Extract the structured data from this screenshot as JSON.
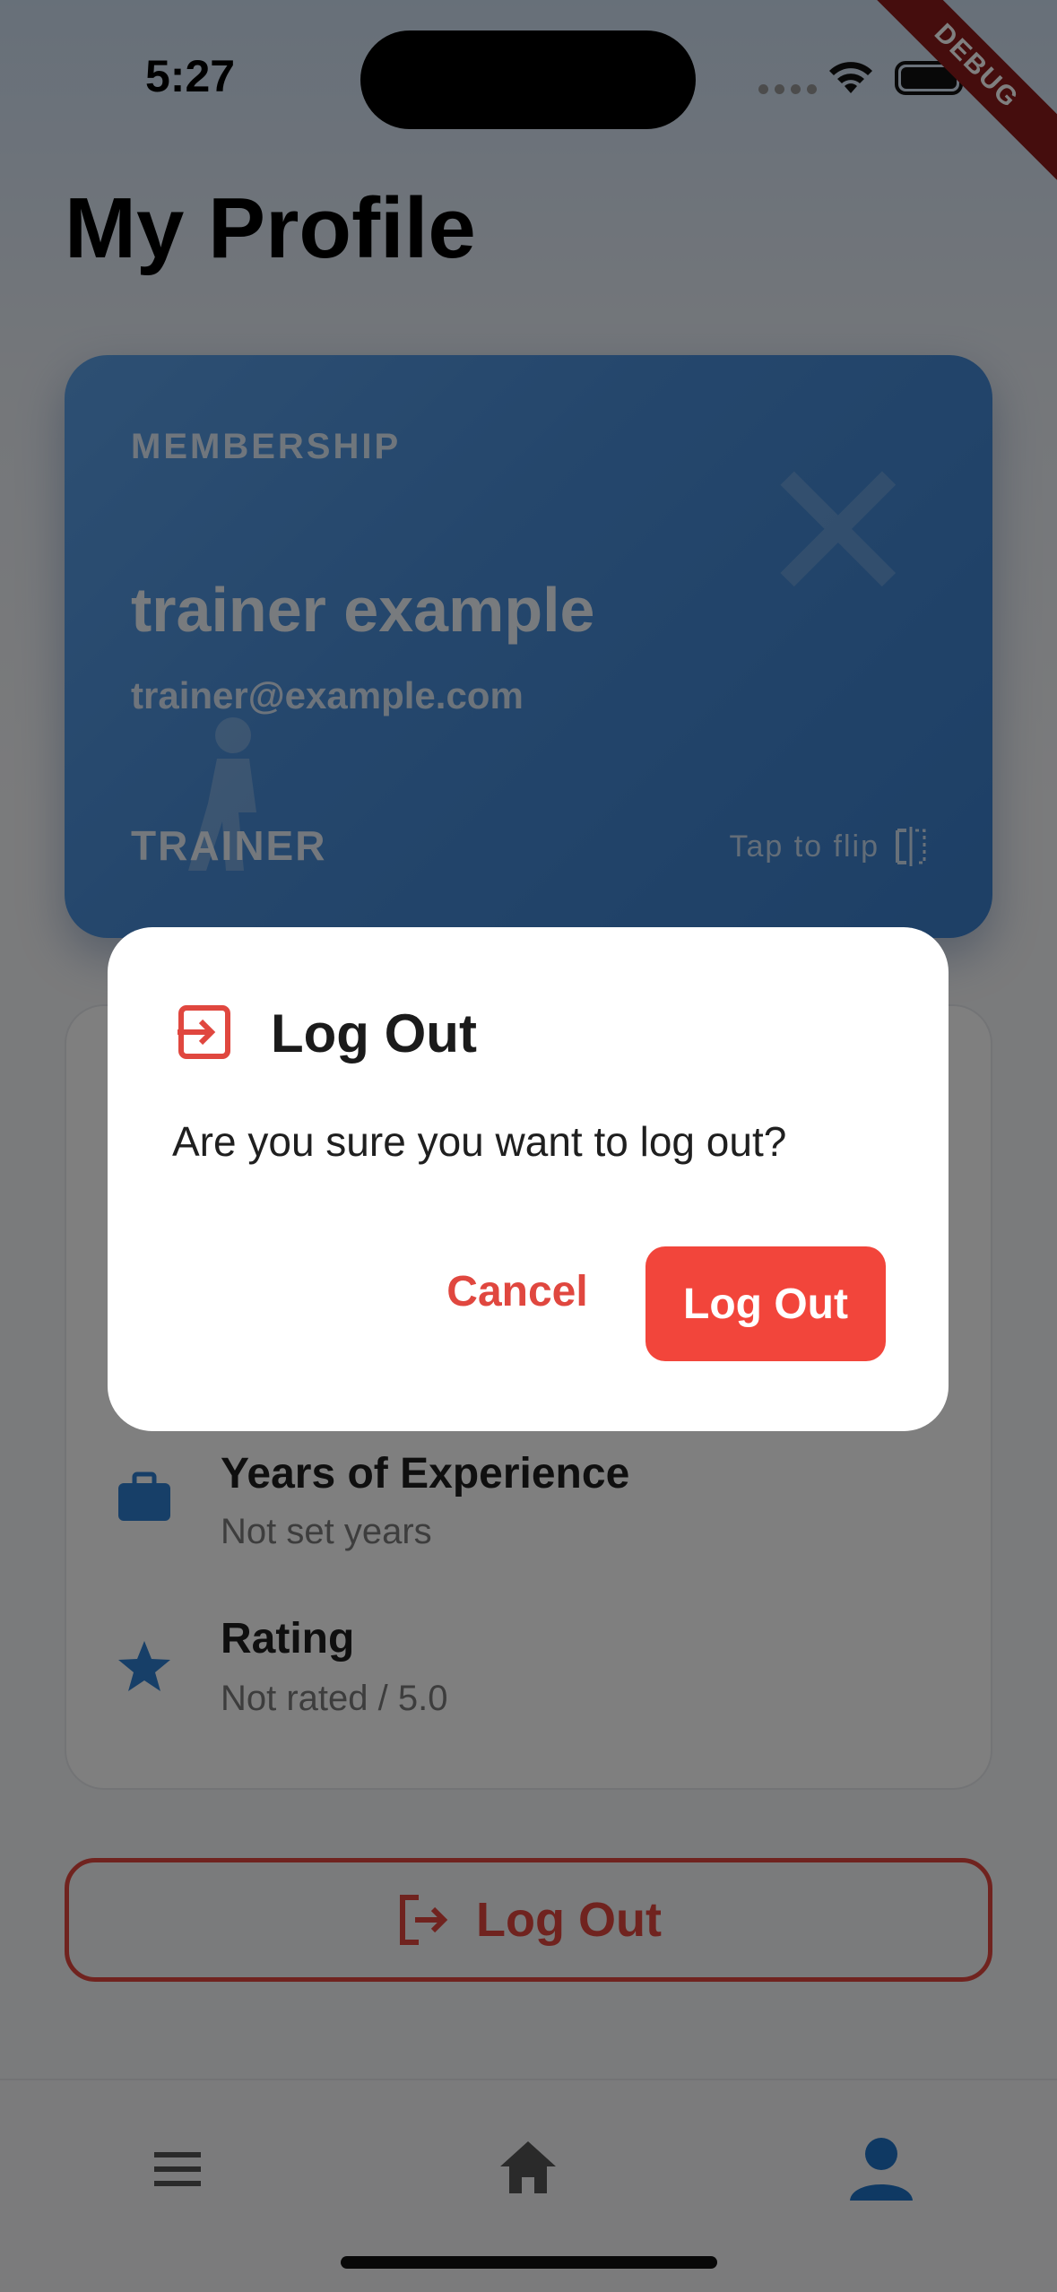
{
  "status_bar": {
    "time": "5:27"
  },
  "debug_banner": "DEBUG",
  "page": {
    "title": "My Profile"
  },
  "membership_card": {
    "label": "MEMBERSHIP",
    "name": "trainer example",
    "email": "trainer@example.com",
    "role": "TRAINER",
    "flip_hint": "Tap to flip"
  },
  "details": [
    {
      "title": "Years of Experience",
      "value": "Not set years",
      "icon": "briefcase-icon"
    },
    {
      "title": "Rating",
      "value": "Not rated / 5.0",
      "icon": "star-icon"
    }
  ],
  "logout_button": {
    "label": "Log Out",
    "icon": "logout-icon"
  },
  "bottom_nav": {
    "items": [
      {
        "name": "menu",
        "icon": "menu-icon",
        "active": false
      },
      {
        "name": "home",
        "icon": "home-icon",
        "active": false
      },
      {
        "name": "profile",
        "icon": "person-icon",
        "active": true
      }
    ]
  },
  "dialog": {
    "title": "Log Out",
    "message": "Are you sure you want to log out?",
    "cancel_label": "Cancel",
    "confirm_label": "Log Out",
    "icon": "logout-icon"
  },
  "colors": {
    "accent_red": "#f2453b",
    "primary_blue": "#1f73c6",
    "card_blue": "#4a8ed9"
  }
}
